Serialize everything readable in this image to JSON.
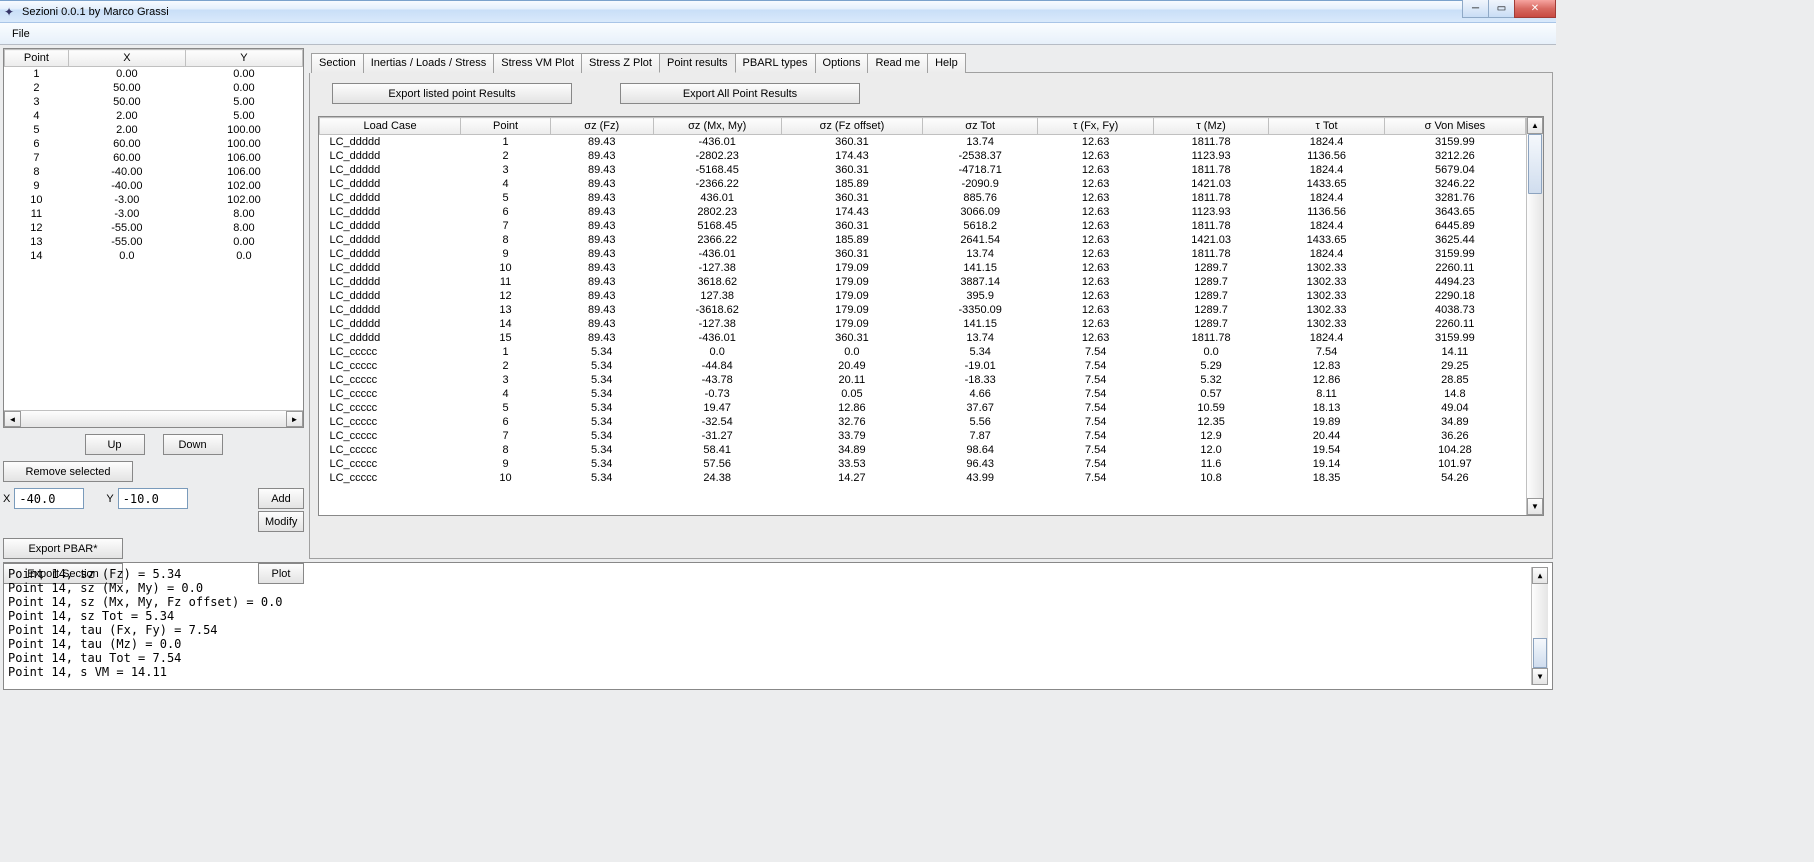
{
  "window": {
    "title": "Sezioni 0.0.1 by Marco Grassi"
  },
  "menu": {
    "file": "File"
  },
  "left": {
    "headers": {
      "point": "Point",
      "x": "X",
      "y": "Y"
    },
    "points": [
      {
        "n": "1",
        "x": "0.00",
        "y": "0.00"
      },
      {
        "n": "2",
        "x": "50.00",
        "y": "0.00"
      },
      {
        "n": "3",
        "x": "50.00",
        "y": "5.00"
      },
      {
        "n": "4",
        "x": "2.00",
        "y": "5.00"
      },
      {
        "n": "5",
        "x": "2.00",
        "y": "100.00"
      },
      {
        "n": "6",
        "x": "60.00",
        "y": "100.00"
      },
      {
        "n": "7",
        "x": "60.00",
        "y": "106.00"
      },
      {
        "n": "8",
        "x": "-40.00",
        "y": "106.00"
      },
      {
        "n": "9",
        "x": "-40.00",
        "y": "102.00"
      },
      {
        "n": "10",
        "x": "-3.00",
        "y": "102.00"
      },
      {
        "n": "11",
        "x": "-3.00",
        "y": "8.00"
      },
      {
        "n": "12",
        "x": "-55.00",
        "y": "8.00"
      },
      {
        "n": "13",
        "x": "-55.00",
        "y": "0.00"
      },
      {
        "n": "14",
        "x": "0.0",
        "y": "0.0"
      }
    ],
    "buttons": {
      "up": "Up",
      "down": "Down",
      "remove": "Remove selected",
      "add": "Add",
      "modify": "Modify",
      "export_pbar": "Export PBAR*",
      "export_section": "Export Section",
      "plot": "Plot"
    },
    "labels": {
      "x": "X",
      "y": "Y"
    },
    "inputs": {
      "x": "-40.0",
      "y": "-10.0"
    }
  },
  "tabs": [
    "Section",
    "Inertias / Loads / Stress",
    "Stress VM Plot",
    "Stress Z Plot",
    "Point results",
    "PBARL types",
    "Options",
    "Read me",
    "Help"
  ],
  "active_tab": "Point results",
  "export": {
    "listed": "Export listed point Results",
    "all": "Export All Point Results"
  },
  "results": {
    "headers": [
      "Load Case",
      "Point",
      "σz (Fz)",
      "σz (Mx, My)",
      "σz (Fz offset)",
      "σz Tot",
      "τ (Fx, Fy)",
      "τ (Mz)",
      "τ Tot",
      "σ Von Mises"
    ],
    "rows": [
      [
        "LC_ddddd",
        "1",
        "89.43",
        "-436.01",
        "360.31",
        "13.74",
        "12.63",
        "1811.78",
        "1824.4",
        "3159.99"
      ],
      [
        "LC_ddddd",
        "2",
        "89.43",
        "-2802.23",
        "174.43",
        "-2538.37",
        "12.63",
        "1123.93",
        "1136.56",
        "3212.26"
      ],
      [
        "LC_ddddd",
        "3",
        "89.43",
        "-5168.45",
        "360.31",
        "-4718.71",
        "12.63",
        "1811.78",
        "1824.4",
        "5679.04"
      ],
      [
        "LC_ddddd",
        "4",
        "89.43",
        "-2366.22",
        "185.89",
        "-2090.9",
        "12.63",
        "1421.03",
        "1433.65",
        "3246.22"
      ],
      [
        "LC_ddddd",
        "5",
        "89.43",
        "436.01",
        "360.31",
        "885.76",
        "12.63",
        "1811.78",
        "1824.4",
        "3281.76"
      ],
      [
        "LC_ddddd",
        "6",
        "89.43",
        "2802.23",
        "174.43",
        "3066.09",
        "12.63",
        "1123.93",
        "1136.56",
        "3643.65"
      ],
      [
        "LC_ddddd",
        "7",
        "89.43",
        "5168.45",
        "360.31",
        "5618.2",
        "12.63",
        "1811.78",
        "1824.4",
        "6445.89"
      ],
      [
        "LC_ddddd",
        "8",
        "89.43",
        "2366.22",
        "185.89",
        "2641.54",
        "12.63",
        "1421.03",
        "1433.65",
        "3625.44"
      ],
      [
        "LC_ddddd",
        "9",
        "89.43",
        "-436.01",
        "360.31",
        "13.74",
        "12.63",
        "1811.78",
        "1824.4",
        "3159.99"
      ],
      [
        "LC_ddddd",
        "10",
        "89.43",
        "-127.38",
        "179.09",
        "141.15",
        "12.63",
        "1289.7",
        "1302.33",
        "2260.11"
      ],
      [
        "LC_ddddd",
        "11",
        "89.43",
        "3618.62",
        "179.09",
        "3887.14",
        "12.63",
        "1289.7",
        "1302.33",
        "4494.23"
      ],
      [
        "LC_ddddd",
        "12",
        "89.43",
        "127.38",
        "179.09",
        "395.9",
        "12.63",
        "1289.7",
        "1302.33",
        "2290.18"
      ],
      [
        "LC_ddddd",
        "13",
        "89.43",
        "-3618.62",
        "179.09",
        "-3350.09",
        "12.63",
        "1289.7",
        "1302.33",
        "4038.73"
      ],
      [
        "LC_ddddd",
        "14",
        "89.43",
        "-127.38",
        "179.09",
        "141.15",
        "12.63",
        "1289.7",
        "1302.33",
        "2260.11"
      ],
      [
        "LC_ddddd",
        "15",
        "89.43",
        "-436.01",
        "360.31",
        "13.74",
        "12.63",
        "1811.78",
        "1824.4",
        "3159.99"
      ],
      [
        "LC_ccccc",
        "1",
        "5.34",
        "0.0",
        "0.0",
        "5.34",
        "7.54",
        "0.0",
        "7.54",
        "14.11"
      ],
      [
        "LC_ccccc",
        "2",
        "5.34",
        "-44.84",
        "20.49",
        "-19.01",
        "7.54",
        "5.29",
        "12.83",
        "29.25"
      ],
      [
        "LC_ccccc",
        "3",
        "5.34",
        "-43.78",
        "20.11",
        "-18.33",
        "7.54",
        "5.32",
        "12.86",
        "28.85"
      ],
      [
        "LC_ccccc",
        "4",
        "5.34",
        "-0.73",
        "0.05",
        "4.66",
        "7.54",
        "0.57",
        "8.11",
        "14.8"
      ],
      [
        "LC_ccccc",
        "5",
        "5.34",
        "19.47",
        "12.86",
        "37.67",
        "7.54",
        "10.59",
        "18.13",
        "49.04"
      ],
      [
        "LC_ccccc",
        "6",
        "5.34",
        "-32.54",
        "32.76",
        "5.56",
        "7.54",
        "12.35",
        "19.89",
        "34.89"
      ],
      [
        "LC_ccccc",
        "7",
        "5.34",
        "-31.27",
        "33.79",
        "7.87",
        "7.54",
        "12.9",
        "20.44",
        "36.26"
      ],
      [
        "LC_ccccc",
        "8",
        "5.34",
        "58.41",
        "34.89",
        "98.64",
        "7.54",
        "12.0",
        "19.54",
        "104.28"
      ],
      [
        "LC_ccccc",
        "9",
        "5.34",
        "57.56",
        "33.53",
        "96.43",
        "7.54",
        "11.6",
        "19.14",
        "101.97"
      ],
      [
        "LC_ccccc",
        "10",
        "5.34",
        "24.38",
        "14.27",
        "43.99",
        "7.54",
        "10.8",
        "18.35",
        "54.26"
      ]
    ]
  },
  "log": "Point 14, sz (Fz) = 5.34\nPoint 14, sz (Mx, My) = 0.0\nPoint 14, sz (Mx, My, Fz offset) = 0.0\nPoint 14, sz Tot = 5.34\nPoint 14, tau (Fx, Fy) = 7.54\nPoint 14, tau (Mz) = 0.0\nPoint 14, tau Tot = 7.54\nPoint 14, s VM = 14.11"
}
